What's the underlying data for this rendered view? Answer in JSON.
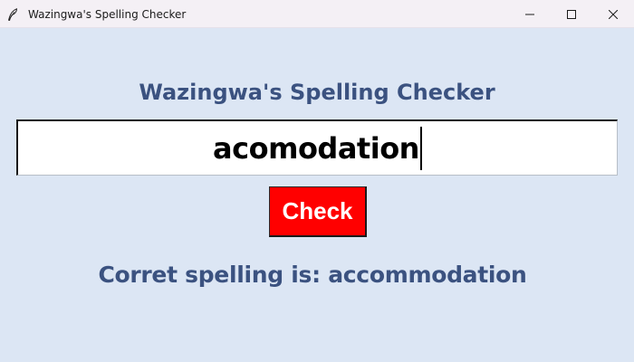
{
  "window": {
    "title": "Wazingwa's Spelling Checker",
    "icon": "feather-icon",
    "controls": [
      "minimize-icon",
      "maximize-icon",
      "close-icon"
    ]
  },
  "app": {
    "heading": "Wazingwa's Spelling Checker",
    "input": {
      "value": "acomodation"
    },
    "check_button": {
      "label": "Check",
      "color": "#ff0000"
    },
    "result_text": "Corret spelling is: accommodation"
  },
  "colors": {
    "background": "#dce6f4",
    "text_accent": "#3b5280",
    "titlebar": "#f4f0f5"
  }
}
